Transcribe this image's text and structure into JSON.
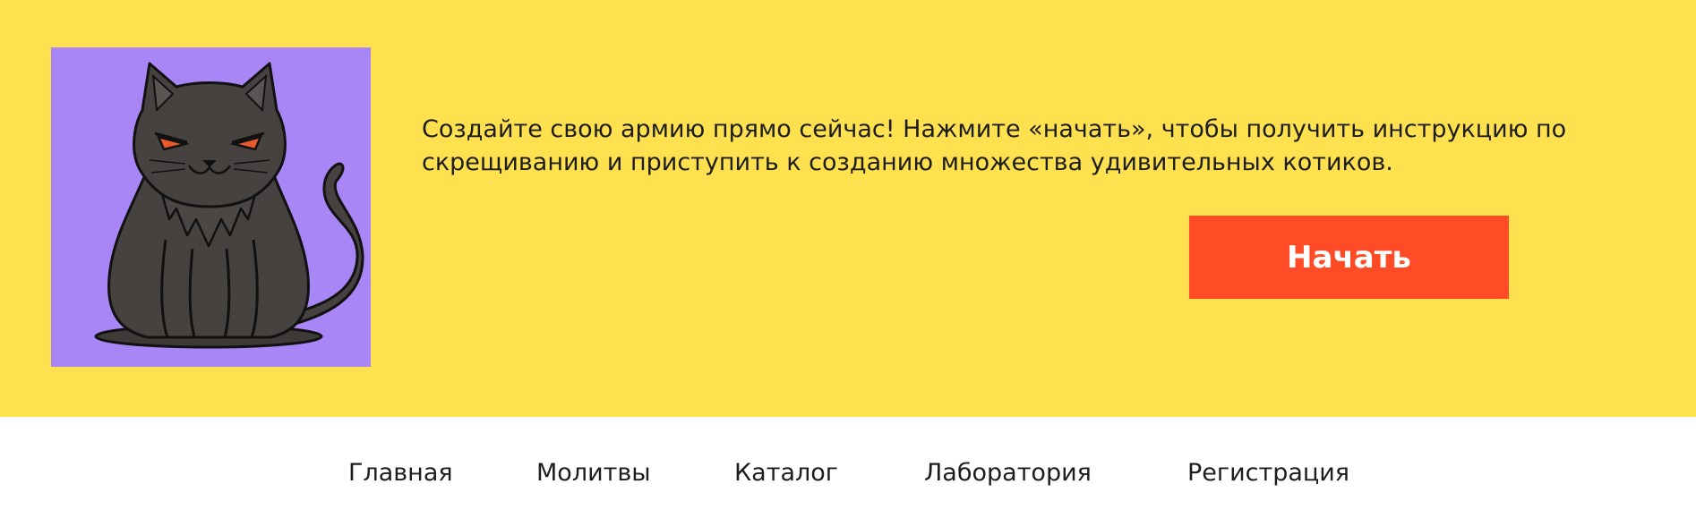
{
  "hero": {
    "background_color": "#FFE14F",
    "image": {
      "icon": "black-cat-illustration",
      "background_color": "#A986F5"
    },
    "text": "Создайте свою армию прямо сейчас! Нажмите «начать», чтобы получить инструкцию по скрещиванию и приступить к созданию множества удивительных котиков.",
    "button": {
      "label": "Начать",
      "color": "#FF4B26"
    }
  },
  "nav": {
    "items": [
      {
        "label": "Главная"
      },
      {
        "label": "Молитвы"
      },
      {
        "label": "Каталог"
      },
      {
        "label": "Лаборатория"
      },
      {
        "label": "Регистрация"
      }
    ]
  }
}
